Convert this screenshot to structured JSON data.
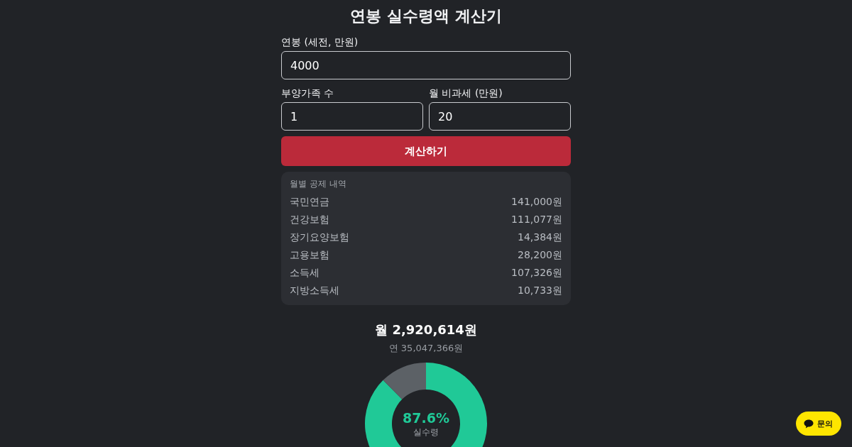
{
  "title": "연봉 실수령액 계산기",
  "fields": [
    {
      "label": "연봉 (세전, 만원)",
      "value": "4000"
    },
    {
      "label": "부양가족 수",
      "value": "1"
    },
    {
      "label": "월 비과세 (만원)",
      "value": "20"
    }
  ],
  "submit_button": "계산하기",
  "deductions": {
    "title": "월별 공제 내역",
    "items": [
      {
        "name": "국민연금",
        "amount": "141,000원"
      },
      {
        "name": "건강보험",
        "amount": "111,077원"
      },
      {
        "name": "장기요양보험",
        "amount": "14,384원"
      },
      {
        "name": "고용보험",
        "amount": "28,200원"
      },
      {
        "name": "소득세",
        "amount": "107,326원"
      },
      {
        "name": "지방소득세",
        "amount": "10,733원"
      }
    ]
  },
  "result": {
    "monthly": "월 2,920,614원",
    "annual": "연 35,047,366원",
    "chart_data": {
      "type": "donut",
      "values": [
        87.6,
        12.4
      ]
    },
    "center_value": "87.6%",
    "center_label": "실수령"
  },
  "chat_button": "문의"
}
